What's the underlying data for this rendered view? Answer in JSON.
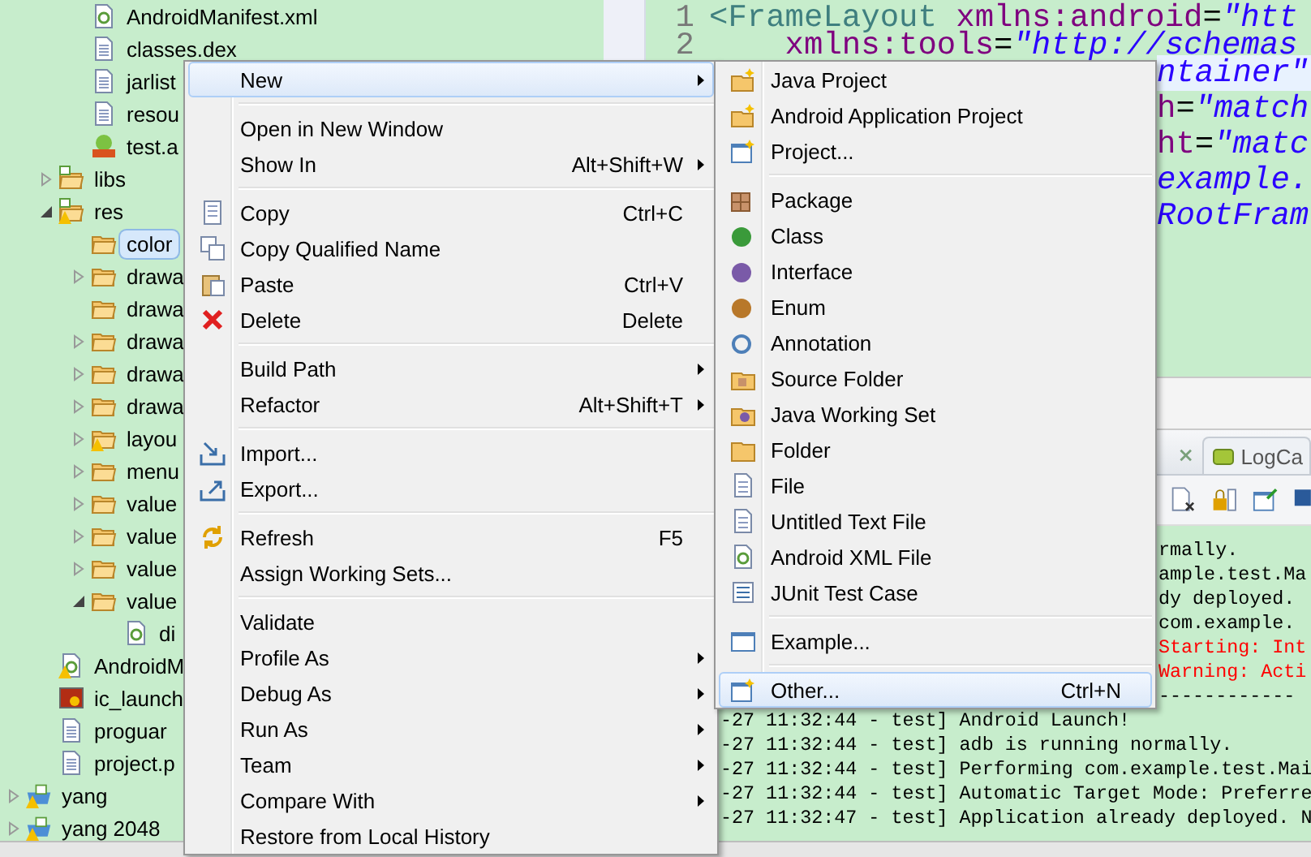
{
  "tree": {
    "items": [
      {
        "children": [
          {
            "children": [
              {
                "label": "AndroidManifest.xml",
                "kind": "xml",
                "selected": false
              },
              {
                "label": "classes.dex",
                "kind": "file",
                "selected": false
              },
              {
                "label": "jarlist",
                "kind": "file",
                "selected": false
              },
              {
                "label": "resou",
                "kind": "file",
                "selected": false
              },
              {
                "label": "test.a",
                "kind": "apk",
                "selected": false
              }
            ]
          },
          {
            "label": "libs",
            "kind": "android-folder",
            "expanded": false,
            "selected": false
          },
          {
            "label": "res",
            "kind": "android-folder",
            "expanded": true,
            "warning": true,
            "selected": false,
            "children": [
              {
                "label": "color",
                "kind": "folder",
                "selected": true
              },
              {
                "label": "drawa",
                "kind": "folder",
                "expanded": false,
                "selected": false
              },
              {
                "label": "drawa",
                "kind": "folder",
                "selected": false
              },
              {
                "label": "drawa",
                "kind": "folder",
                "expanded": false,
                "selected": false
              },
              {
                "label": "drawa",
                "kind": "folder",
                "expanded": false,
                "selected": false
              },
              {
                "label": "drawa",
                "kind": "folder",
                "expanded": false,
                "selected": false
              },
              {
                "label": "layou",
                "kind": "folder",
                "expanded": false,
                "warning": true,
                "selected": false
              },
              {
                "label": "menu",
                "kind": "folder",
                "expanded": false,
                "selected": false
              },
              {
                "label": "value",
                "kind": "folder",
                "expanded": false,
                "selected": false
              },
              {
                "label": "value",
                "kind": "folder",
                "expanded": false,
                "selected": false
              },
              {
                "label": "value",
                "kind": "folder",
                "expanded": false,
                "selected": false
              },
              {
                "label": "value",
                "kind": "folder",
                "expanded": true,
                "selected": false,
                "children": [
                  {
                    "label": "di",
                    "kind": "xml",
                    "selected": false
                  }
                ]
              }
            ]
          },
          {
            "label": "AndroidM",
            "kind": "xml",
            "warning": true,
            "selected": false
          },
          {
            "label": "ic_launch",
            "kind": "image",
            "selected": false
          },
          {
            "label": "proguar",
            "kind": "file",
            "selected": false
          },
          {
            "label": "project.p",
            "kind": "file",
            "selected": false
          }
        ]
      },
      {
        "label": "yang",
        "kind": "project",
        "expanded": false,
        "warning": true,
        "selected": false
      },
      {
        "label": "yang 2048",
        "kind": "project",
        "expanded": false,
        "warning": true,
        "selected": false
      }
    ]
  },
  "editor": {
    "lines": [
      {
        "number": "1",
        "current": false,
        "segments": [
          {
            "text": "<FrameLayout",
            "kind": "tag"
          },
          {
            "text": " xmlns:android",
            "kind": "attr"
          },
          {
            "text": "=",
            "kind": "plain"
          },
          {
            "text": "\"htt",
            "kind": "string"
          }
        ]
      },
      {
        "number": "2",
        "current": false,
        "segments": [
          {
            "text": "    xmlns:tools",
            "kind": "attr"
          },
          {
            "text": "=",
            "kind": "plain"
          },
          {
            "text": "\"http://schemas",
            "kind": "string"
          }
        ]
      }
    ],
    "fragments": [
      {
        "current": true,
        "segments": [
          {
            "text": "ntainer\"",
            "kind": "string"
          }
        ]
      },
      {
        "current": false,
        "segments": [
          {
            "text": "h",
            "kind": "attr"
          },
          {
            "text": "=",
            "kind": "plain"
          },
          {
            "text": "\"match",
            "kind": "string"
          }
        ]
      },
      {
        "current": false,
        "segments": [
          {
            "text": "ht",
            "kind": "attr"
          },
          {
            "text": "=",
            "kind": "plain"
          },
          {
            "text": "\"matc",
            "kind": "string"
          }
        ]
      },
      {
        "current": false,
        "segments": [
          {
            "text": "example.",
            "kind": "string"
          }
        ]
      },
      {
        "current": false,
        "segments": [
          {
            "text": "RootFram",
            "kind": "string"
          }
        ]
      }
    ]
  },
  "console": {
    "tabs": [
      {
        "label": "LogCa",
        "selected": false
      }
    ],
    "fragments": [
      {
        "text": "rmally.",
        "error": false
      },
      {
        "text": "ample.test.Ma",
        "error": false
      },
      {
        "text": "dy deployed.",
        "error": false
      },
      {
        "text": "com.example.",
        "error": false
      },
      {
        "text": "Starting: Int",
        "error": true
      },
      {
        "text": "Warning: Acti",
        "error": true
      },
      {
        "text": "------------",
        "error": false
      }
    ],
    "lines": [
      {
        "text": "-27 11:32:44 - test] Android Launch!",
        "error": false
      },
      {
        "text": "-27 11:32:44 - test] adb is running normally.",
        "error": false
      },
      {
        "text": "-27 11:32:44 - test] Performing com.example.test.Mai",
        "error": false
      },
      {
        "text": "-27 11:32:44 - test] Automatic Target Mode: Preferre",
        "error": false
      },
      {
        "text": "-27 11:32:47 - test] Application already deployed. N",
        "error": false
      }
    ]
  },
  "context_menu": {
    "items": [
      {
        "kind": "item",
        "label": "New",
        "submenu": true,
        "selected": true
      },
      {
        "kind": "separator"
      },
      {
        "kind": "item",
        "label": "Open in New Window",
        "submenu": false,
        "selected": false
      },
      {
        "kind": "item",
        "label": "Show In",
        "shortcut": "Alt+Shift+W",
        "submenu": true,
        "selected": false
      },
      {
        "kind": "separator"
      },
      {
        "kind": "item",
        "label": "Copy",
        "shortcut": "Ctrl+C",
        "submenu": false,
        "selected": false
      },
      {
        "kind": "item",
        "label": "Copy Qualified Name",
        "submenu": false,
        "selected": false
      },
      {
        "kind": "item",
        "label": "Paste",
        "shortcut": "Ctrl+V",
        "submenu": false,
        "selected": false
      },
      {
        "kind": "item",
        "label": "Delete",
        "shortcut": "Delete",
        "submenu": false,
        "selected": false
      },
      {
        "kind": "separator"
      },
      {
        "kind": "item",
        "label": "Build Path",
        "submenu": true,
        "selected": false
      },
      {
        "kind": "item",
        "label": "Refactor",
        "shortcut": "Alt+Shift+T",
        "submenu": true,
        "selected": false
      },
      {
        "kind": "separator"
      },
      {
        "kind": "item",
        "label": "Import...",
        "submenu": false,
        "selected": false
      },
      {
        "kind": "item",
        "label": "Export...",
        "submenu": false,
        "selected": false
      },
      {
        "kind": "separator"
      },
      {
        "kind": "item",
        "label": "Refresh",
        "shortcut": "F5",
        "submenu": false,
        "selected": false
      },
      {
        "kind": "item",
        "label": "Assign Working Sets...",
        "submenu": false,
        "selected": false
      },
      {
        "kind": "separator"
      },
      {
        "kind": "item",
        "label": "Validate",
        "submenu": false,
        "selected": false
      },
      {
        "kind": "item",
        "label": "Profile As",
        "submenu": true,
        "selected": false
      },
      {
        "kind": "item",
        "label": "Debug As",
        "submenu": true,
        "selected": false
      },
      {
        "kind": "item",
        "label": "Run As",
        "submenu": true,
        "selected": false
      },
      {
        "kind": "item",
        "label": "Team",
        "submenu": true,
        "selected": false
      },
      {
        "kind": "item",
        "label": "Compare With",
        "submenu": true,
        "selected": false
      },
      {
        "kind": "item",
        "label": "Restore from Local History",
        "submenu": false,
        "selected": false
      }
    ]
  },
  "new_submenu": {
    "items": [
      {
        "kind": "item",
        "label": "Java Project",
        "selected": false
      },
      {
        "kind": "item",
        "label": "Android Application Project",
        "selected": false
      },
      {
        "kind": "item",
        "label": "Project...",
        "selected": false
      },
      {
        "kind": "separator"
      },
      {
        "kind": "item",
        "label": "Package",
        "selected": false
      },
      {
        "kind": "item",
        "label": "Class",
        "selected": false
      },
      {
        "kind": "item",
        "label": "Interface",
        "selected": false
      },
      {
        "kind": "item",
        "label": "Enum",
        "selected": false
      },
      {
        "kind": "item",
        "label": "Annotation",
        "selected": false
      },
      {
        "kind": "item",
        "label": "Source Folder",
        "selected": false
      },
      {
        "kind": "item",
        "label": "Java Working Set",
        "selected": false
      },
      {
        "kind": "item",
        "label": "Folder",
        "selected": false
      },
      {
        "kind": "item",
        "label": "File",
        "selected": false
      },
      {
        "kind": "item",
        "label": "Untitled Text File",
        "selected": false
      },
      {
        "kind": "item",
        "label": "Android XML File",
        "selected": false
      },
      {
        "kind": "item",
        "label": "JUnit Test Case",
        "selected": false
      },
      {
        "kind": "separator"
      },
      {
        "kind": "item",
        "label": "Example...",
        "selected": false
      },
      {
        "kind": "separator"
      },
      {
        "kind": "item",
        "label": "Other...",
        "shortcut": "Ctrl+N",
        "selected": true
      }
    ]
  }
}
